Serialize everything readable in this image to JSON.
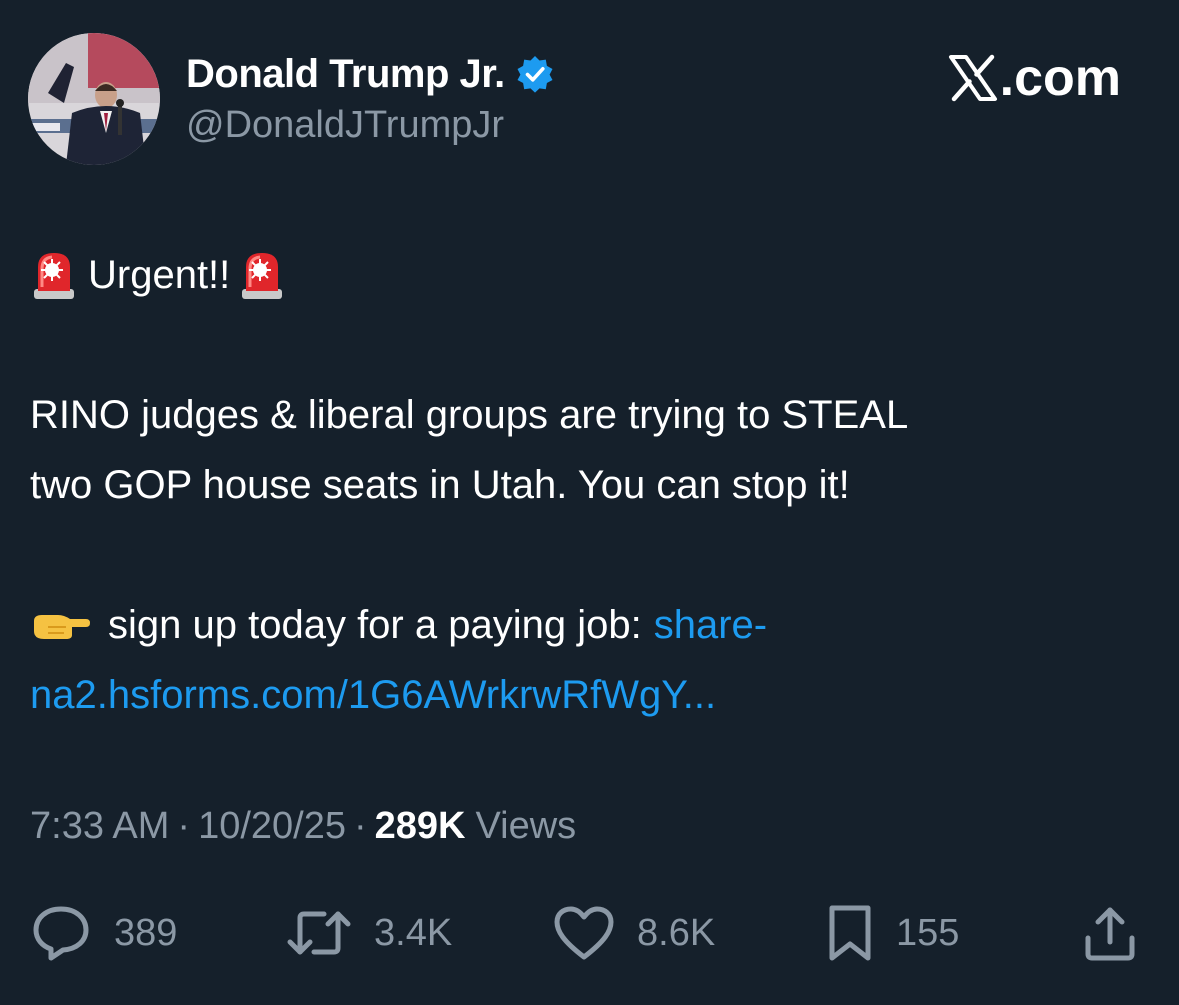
{
  "header": {
    "display_name": "Donald Trump Jr.",
    "handle": "@DonaldJTrumpJr",
    "verified_icon": "verified-badge-icon",
    "site_logo": ".com",
    "colors": {
      "background": "#15202b",
      "text": "#ffffff",
      "secondary": "#8b98a5",
      "accent": "#1d9bf0"
    }
  },
  "tweet": {
    "urgent_text": "Urgent!!",
    "line1": "RINO judges & liberal groups are trying to STEAL",
    "line2": "two GOP house seats in Utah. You can stop it!",
    "cta_text": "sign up today for a paying job:",
    "link_part1": "share-",
    "link_part2": "na2.hsforms.com/1G6AWrkrwRfWgY..."
  },
  "meta": {
    "time": "7:33 AM",
    "date": "10/20/25",
    "views_count": "289K",
    "views_label": "Views"
  },
  "actions": {
    "replies": "389",
    "retweets": "3.4K",
    "likes": "8.6K",
    "bookmarks": "155"
  }
}
